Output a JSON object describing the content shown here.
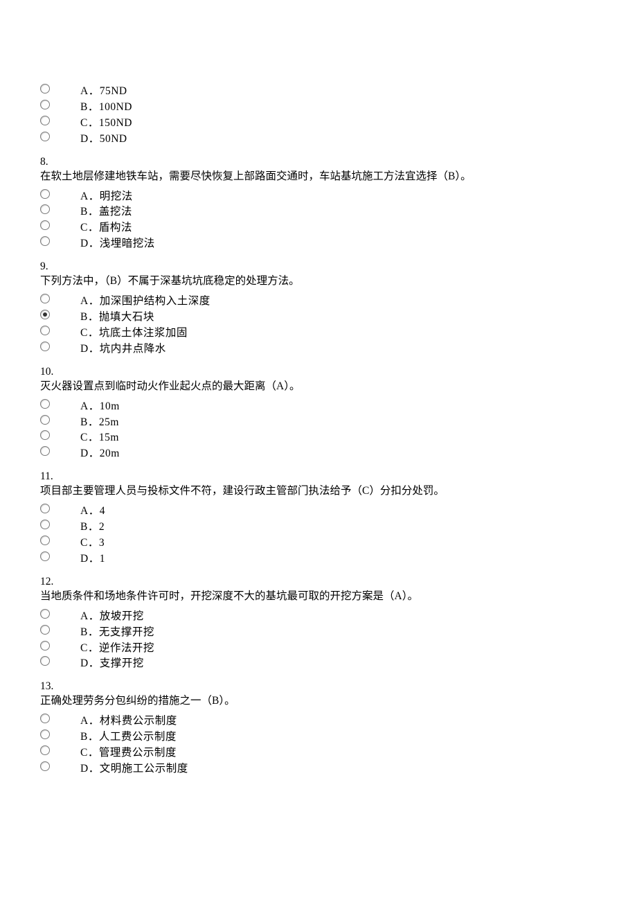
{
  "questions": [
    {
      "number": "",
      "stem": "",
      "options": [
        {
          "label": "A．75ND",
          "selected": false
        },
        {
          "label": "B．100ND",
          "selected": false
        },
        {
          "label": "C．150ND",
          "selected": false
        },
        {
          "label": "D．50ND",
          "selected": false
        }
      ]
    },
    {
      "number": "8.",
      "stem": "在软土地层修建地铁车站，需要尽快恢复上部路面交通时，车站基坑施工方法宜选择（B）。",
      "options": [
        {
          "label": "A．明挖法",
          "selected": false
        },
        {
          "label": "B．盖挖法",
          "selected": false
        },
        {
          "label": "C．盾构法",
          "selected": false
        },
        {
          "label": "D．浅埋暗挖法",
          "selected": false
        }
      ]
    },
    {
      "number": "9.",
      "stem": "下列方法中，（B）不属于深基坑坑底稳定的处理方法。",
      "options": [
        {
          "label": "A．加深围护结构入土深度",
          "selected": false
        },
        {
          "label": "B．抛填大石块",
          "selected": true
        },
        {
          "label": "C．坑底土体注浆加固",
          "selected": false
        },
        {
          "label": "D．坑内井点降水",
          "selected": false
        }
      ]
    },
    {
      "number": "10.",
      "stem": "灭火器设置点到临时动火作业起火点的最大距离（A）。",
      "options": [
        {
          "label": "A．10m",
          "selected": false
        },
        {
          "label": "B．25m",
          "selected": false
        },
        {
          "label": "C．15m",
          "selected": false
        },
        {
          "label": "D．20m",
          "selected": false
        }
      ]
    },
    {
      "number": "11.",
      "stem": "项目部主要管理人员与投标文件不符，建设行政主管部门执法给予（C）分扣分处罚。",
      "options": [
        {
          "label": "A．4",
          "selected": false
        },
        {
          "label": "B．2",
          "selected": false
        },
        {
          "label": "C．3",
          "selected": false
        },
        {
          "label": "D．1",
          "selected": false
        }
      ]
    },
    {
      "number": "12.",
      "stem": "当地质条件和场地条件许可时，开挖深度不大的基坑最可取的开挖方案是（A）。",
      "options": [
        {
          "label": "A．放坡开挖",
          "selected": false
        },
        {
          "label": "B．无支撑开挖",
          "selected": false
        },
        {
          "label": "C．逆作法开挖",
          "selected": false
        },
        {
          "label": "D．支撑开挖",
          "selected": false
        }
      ]
    },
    {
      "number": "13.",
      "stem": "正确处理劳务分包纠纷的措施之一（B）。",
      "options": [
        {
          "label": "A．材料费公示制度",
          "selected": false
        },
        {
          "label": "B．人工费公示制度",
          "selected": false
        },
        {
          "label": "C．管理费公示制度",
          "selected": false
        },
        {
          "label": "D．文明施工公示制度",
          "selected": false
        }
      ]
    }
  ]
}
